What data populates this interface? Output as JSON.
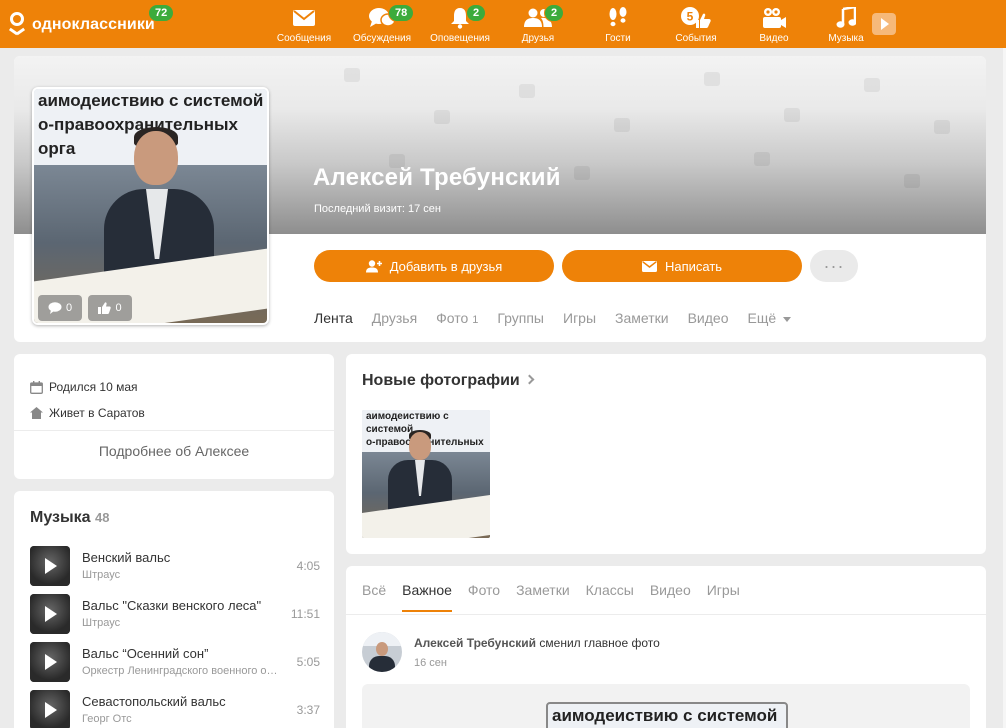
{
  "topbar": {
    "logo_text": "одноклассники",
    "logo_badge": "72",
    "nav": [
      {
        "label": "Сообщения",
        "icon": "envelope-icon",
        "badge": ""
      },
      {
        "label": "Обсуждения",
        "icon": "chat-icon",
        "badge": "78"
      },
      {
        "label": "Оповещения",
        "icon": "bell-icon",
        "badge": "2"
      },
      {
        "label": "Друзья",
        "icon": "friends-icon",
        "badge": "2"
      },
      {
        "label": "Гости",
        "icon": "footprints-icon",
        "badge": ""
      },
      {
        "label": "События",
        "icon": "events-icon",
        "badge": ""
      },
      {
        "label": "Видео",
        "icon": "video-camera-icon",
        "badge": ""
      },
      {
        "label": "Музыка",
        "icon": "music-note-icon",
        "badge": ""
      }
    ],
    "events_icon_num": "5"
  },
  "profile": {
    "name": "Алексей Требунский",
    "last_visit": "Последний визит: 17 сен",
    "avatar_banner": "аимодеиствию с системой\nо-правоохранительных орга\nию коррупции",
    "avatar_comments": "0",
    "avatar_likes": "0",
    "add_friend_label": "Добавить в друзья",
    "write_label": "Написать",
    "more_label": "···",
    "tabs": [
      {
        "label": "Лента",
        "count": ""
      },
      {
        "label": "Друзья",
        "count": ""
      },
      {
        "label": "Фото",
        "count": "1"
      },
      {
        "label": "Группы",
        "count": ""
      },
      {
        "label": "Игры",
        "count": ""
      },
      {
        "label": "Заметки",
        "count": ""
      },
      {
        "label": "Видео",
        "count": ""
      },
      {
        "label": "Ещё",
        "count": ""
      }
    ]
  },
  "about": {
    "birthday": "Родился 10 мая",
    "lives": "Живет в Саратов",
    "more": "Подробнее об Алексее"
  },
  "music": {
    "title": "Музыка",
    "count": "48",
    "tracks": [
      {
        "name": "Венский вальс",
        "artist": "Штраус",
        "duration": "4:05"
      },
      {
        "name": "Вальс \"Сказки венского леса\"",
        "artist": "Штраус",
        "duration": "11:51"
      },
      {
        "name": "Вальс “Осенний сон”",
        "artist": "Оркестр Ленинградского военного округа",
        "duration": "5:05"
      },
      {
        "name": "Севастопольский вальс",
        "artist": "Георг Отс",
        "duration": "3:37"
      }
    ]
  },
  "photos": {
    "title": "Новые фотографии",
    "thumb_banner": "аимодеиствию с системой\nо-правоохранительных орга\nию коррупции"
  },
  "feed": {
    "tabs": [
      "Всё",
      "Важное",
      "Фото",
      "Заметки",
      "Классы",
      "Видео",
      "Игры"
    ],
    "active_tab": "Важное",
    "author": "Алексей Требунский",
    "action": "сменил главное фото",
    "time": "16 сен",
    "media_banner": "аимодеиствию с системой"
  },
  "colors": {
    "brand": "#ee8208",
    "badge": "#3cab3c"
  }
}
